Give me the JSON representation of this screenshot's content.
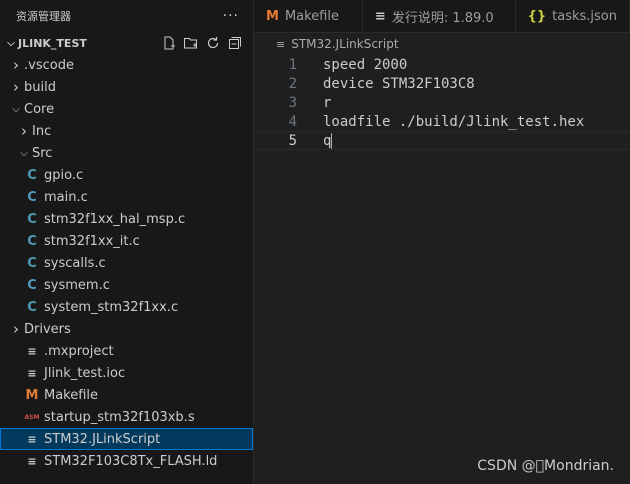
{
  "explorer": {
    "header_title": "资源管理器",
    "more_label": "···",
    "workspace": "JLINK_TEST"
  },
  "tree": [
    {
      "label": ".vscode",
      "kind": "folder-closed",
      "depth": 1
    },
    {
      "label": "build",
      "kind": "folder-closed",
      "depth": 1
    },
    {
      "label": "Core",
      "kind": "folder-open",
      "depth": 1
    },
    {
      "label": "Inc",
      "kind": "folder-closed",
      "depth": 2
    },
    {
      "label": "Src",
      "kind": "folder-open",
      "depth": 2
    },
    {
      "label": "gpio.c",
      "kind": "c-file",
      "depth": 3
    },
    {
      "label": "main.c",
      "kind": "c-file",
      "depth": 3
    },
    {
      "label": "stm32f1xx_hal_msp.c",
      "kind": "c-file",
      "depth": 3
    },
    {
      "label": "stm32f1xx_it.c",
      "kind": "c-file",
      "depth": 3
    },
    {
      "label": "syscalls.c",
      "kind": "c-file",
      "depth": 3
    },
    {
      "label": "sysmem.c",
      "kind": "c-file",
      "depth": 3
    },
    {
      "label": "system_stm32f1xx.c",
      "kind": "c-file",
      "depth": 3
    },
    {
      "label": "Drivers",
      "kind": "folder-closed",
      "depth": 1
    },
    {
      "label": ".mxproject",
      "kind": "text-file",
      "depth": 1
    },
    {
      "label": "Jlink_test.ioc",
      "kind": "text-file",
      "depth": 1
    },
    {
      "label": "Makefile",
      "kind": "makefile",
      "depth": 1
    },
    {
      "label": "startup_stm32f103xb.s",
      "kind": "asm-file",
      "depth": 1
    },
    {
      "label": "STM32.JLinkScript",
      "kind": "text-file",
      "depth": 1,
      "selected": true
    },
    {
      "label": "STM32F103C8Tx_FLASH.ld",
      "kind": "text-file",
      "depth": 1
    }
  ],
  "tabs": [
    {
      "label": "Makefile",
      "icon": "M"
    },
    {
      "label": "发行说明: 1.89.0",
      "icon": "≡"
    },
    {
      "label": "tasks.json",
      "icon": "{}"
    }
  ],
  "breadcrumb": "STM32.JLinkScript",
  "code_lines": [
    {
      "n": "1",
      "text": "speed 2000"
    },
    {
      "n": "2",
      "text": "device STM32F103C8"
    },
    {
      "n": "3",
      "text": "r"
    },
    {
      "n": "4",
      "text": "loadfile ./build/Jlink_test.hex"
    },
    {
      "n": "5",
      "text": "q"
    }
  ],
  "watermark": "CSDN @\u0000Mondrian.",
  "colors": {
    "accent": "#0078d4",
    "selection": "#04395e",
    "c_icon": "#519aba",
    "make_icon": "#e37933"
  }
}
